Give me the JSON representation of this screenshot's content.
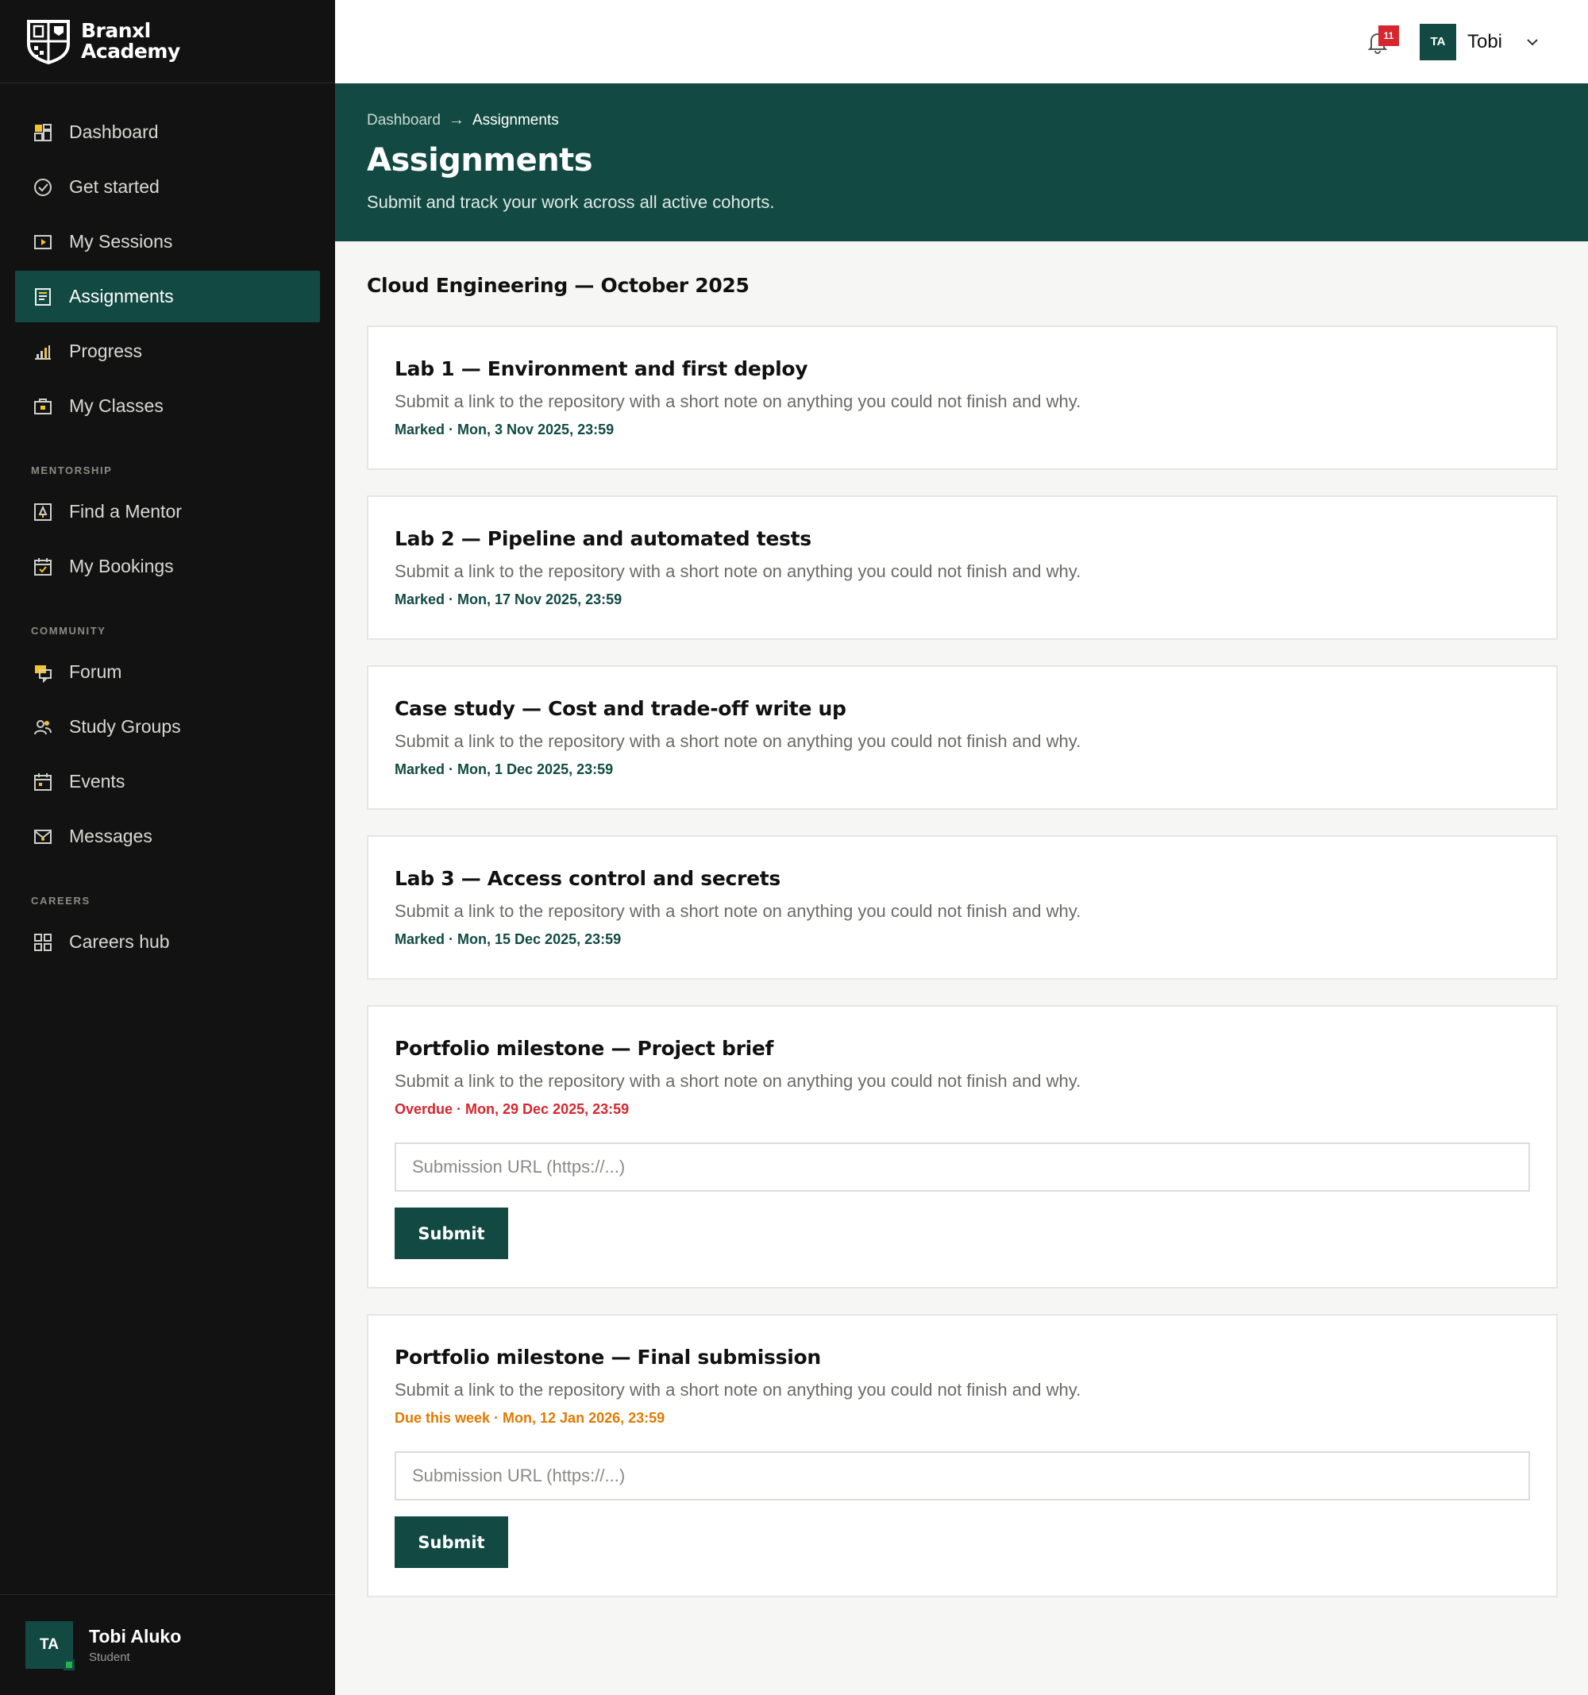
{
  "brand": {
    "line1": "Branxl",
    "line2": "Academy"
  },
  "sidebar": {
    "main_items": [
      {
        "label": "Dashboard",
        "icon": "dashboard-icon"
      },
      {
        "label": "Get started",
        "icon": "check-circle-icon"
      },
      {
        "label": "My Sessions",
        "icon": "play-icon"
      },
      {
        "label": "Assignments",
        "icon": "document-icon",
        "active": true
      },
      {
        "label": "Progress",
        "icon": "bar-chart-icon"
      },
      {
        "label": "My Classes",
        "icon": "briefcase-icon"
      }
    ],
    "sections": [
      {
        "label": "MENTORSHIP",
        "items": [
          {
            "label": "Find a Mentor",
            "icon": "mentor-icon"
          },
          {
            "label": "My Bookings",
            "icon": "calendar-check-icon"
          }
        ]
      },
      {
        "label": "COMMUNITY",
        "items": [
          {
            "label": "Forum",
            "icon": "chat-bubbles-icon"
          },
          {
            "label": "Study Groups",
            "icon": "people-icon"
          },
          {
            "label": "Events",
            "icon": "calendar-icon"
          },
          {
            "label": "Messages",
            "icon": "mail-icon"
          }
        ]
      },
      {
        "label": "CAREERS",
        "items": [
          {
            "label": "Careers hub",
            "icon": "grid-icon"
          }
        ]
      }
    ],
    "user": {
      "initials": "TA",
      "name": "Tobi Aluko",
      "role": "Student"
    }
  },
  "topbar": {
    "notification_count": "11",
    "user_initials": "TA",
    "user_name": "Tobi"
  },
  "hero": {
    "breadcrumb_root": "Dashboard",
    "breadcrumb_current": "Assignments",
    "title": "Assignments",
    "subtitle": "Submit and track your work across all active cohorts."
  },
  "cohort": {
    "title": "Cloud Engineering — October 2025",
    "assignments": [
      {
        "title": "Lab 1 — Environment and first deploy",
        "description": "Submit a link to the repository with a short note on anything you could not finish and why.",
        "status": "Marked · Mon, 3 Nov 2025, 23:59",
        "state": "marked"
      },
      {
        "title": "Lab 2 — Pipeline and automated tests",
        "description": "Submit a link to the repository with a short note on anything you could not finish and why.",
        "status": "Marked · Mon, 17 Nov 2025, 23:59",
        "state": "marked"
      },
      {
        "title": "Case study — Cost and trade-off write up",
        "description": "Submit a link to the repository with a short note on anything you could not finish and why.",
        "status": "Marked · Mon, 1 Dec 2025, 23:59",
        "state": "marked"
      },
      {
        "title": "Lab 3 — Access control and secrets",
        "description": "Submit a link to the repository with a short note on anything you could not finish and why.",
        "status": "Marked · Mon, 15 Dec 2025, 23:59",
        "state": "marked"
      },
      {
        "title": "Portfolio milestone — Project brief",
        "description": "Submit a link to the repository with a short note on anything you could not finish and why.",
        "status": "Overdue · Mon, 29 Dec 2025, 23:59",
        "state": "overdue",
        "input_placeholder": "Submission URL (https://...)",
        "input_value": "",
        "submit_label": "Submit"
      },
      {
        "title": "Portfolio milestone — Final submission",
        "description": "Submit a link to the repository with a short note on anything you could not finish and why.",
        "status": "Due this week · Mon, 12 Jan 2026, 23:59",
        "state": "due",
        "input_placeholder": "Submission URL (https://...)",
        "input_value": "",
        "submit_label": "Submit"
      }
    ]
  },
  "colors": {
    "brand": "#124a43",
    "sidebar": "#121212",
    "overdue": "#d7262e",
    "due": "#e07a00",
    "accent_icon": "#f2c230"
  }
}
